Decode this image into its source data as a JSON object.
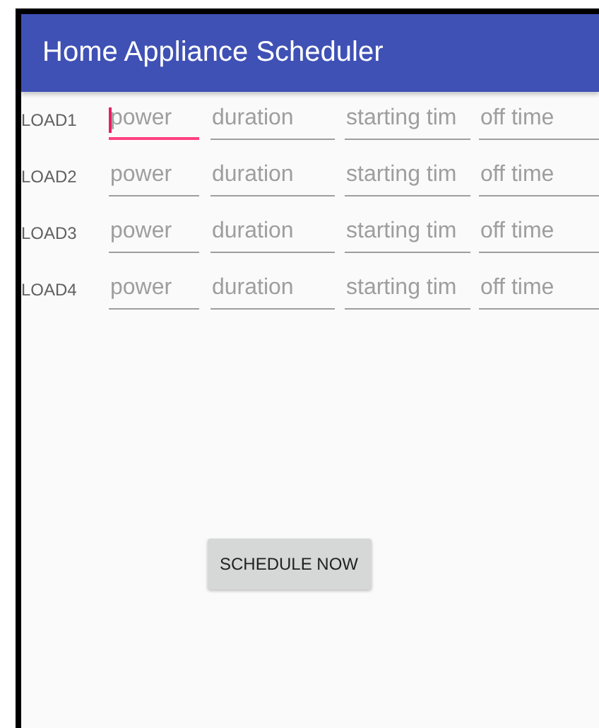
{
  "app_bar": {
    "title": "Home Appliance Scheduler"
  },
  "loads": [
    {
      "label": "LOAD1",
      "fields": [
        {
          "placeholder": "power",
          "focused": true
        },
        {
          "placeholder": "duration",
          "focused": false
        },
        {
          "placeholder": "starting tim",
          "focused": false
        },
        {
          "placeholder": "off time",
          "focused": false
        }
      ]
    },
    {
      "label": "LOAD2",
      "fields": [
        {
          "placeholder": "power",
          "focused": false
        },
        {
          "placeholder": "duration",
          "focused": false
        },
        {
          "placeholder": "starting tim",
          "focused": false
        },
        {
          "placeholder": "off time",
          "focused": false
        }
      ]
    },
    {
      "label": "LOAD3",
      "fields": [
        {
          "placeholder": "power",
          "focused": false
        },
        {
          "placeholder": "duration",
          "focused": false
        },
        {
          "placeholder": "starting tim",
          "focused": false
        },
        {
          "placeholder": "off time",
          "focused": false
        }
      ]
    },
    {
      "label": "LOAD4",
      "fields": [
        {
          "placeholder": "power",
          "focused": false
        },
        {
          "placeholder": "duration",
          "focused": false
        },
        {
          "placeholder": "starting tim",
          "focused": false
        },
        {
          "placeholder": "off time",
          "focused": false
        }
      ]
    }
  ],
  "button": {
    "label": "SCHEDULE NOW"
  }
}
